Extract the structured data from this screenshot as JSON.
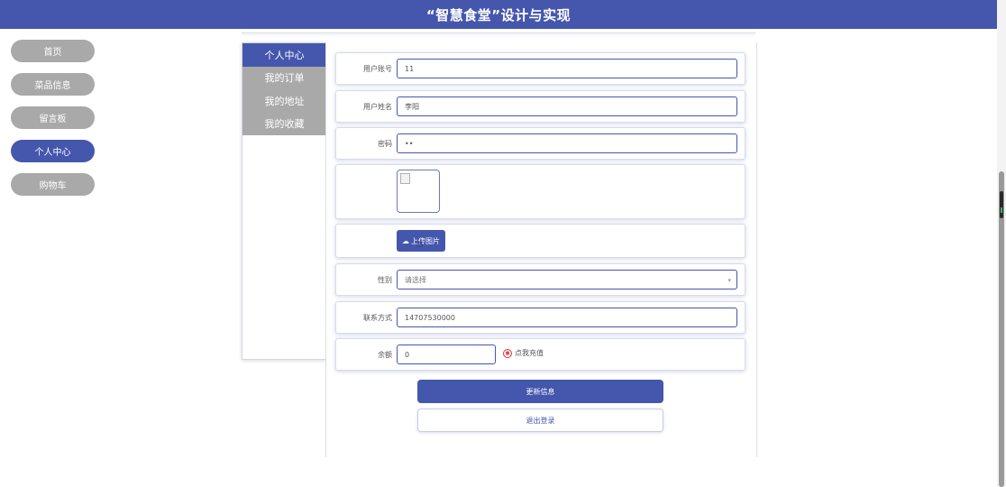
{
  "header": {
    "title": "“智慧食堂”设计与实现"
  },
  "nav": {
    "items": [
      {
        "label": "首页"
      },
      {
        "label": "菜品信息"
      },
      {
        "label": "留言板"
      },
      {
        "label": "个人中心"
      },
      {
        "label": "购物车"
      }
    ],
    "active": "个人中心"
  },
  "side_tabs": [
    {
      "label": "个人中心"
    },
    {
      "label": "我的订单"
    },
    {
      "label": "我的地址"
    },
    {
      "label": "我的收藏"
    }
  ],
  "form": {
    "account": {
      "label": "用户账号",
      "value": "11"
    },
    "name": {
      "label": "用户姓名",
      "value": "李阳"
    },
    "password": {
      "label": "密码",
      "value": "••"
    },
    "upload_label": "上传图片",
    "gender": {
      "label": "性别",
      "placeholder": "请选择"
    },
    "phone": {
      "label": "联系方式",
      "value": "14707530000"
    },
    "balance": {
      "label": "余额",
      "value": "0"
    },
    "recharge_label": "点我充值"
  },
  "actions": {
    "update": "更新信息",
    "logout": "退出登录"
  },
  "colors": {
    "primary": "#4556ad",
    "inactive": "#a9a9a9",
    "danger": "#dd3333"
  }
}
